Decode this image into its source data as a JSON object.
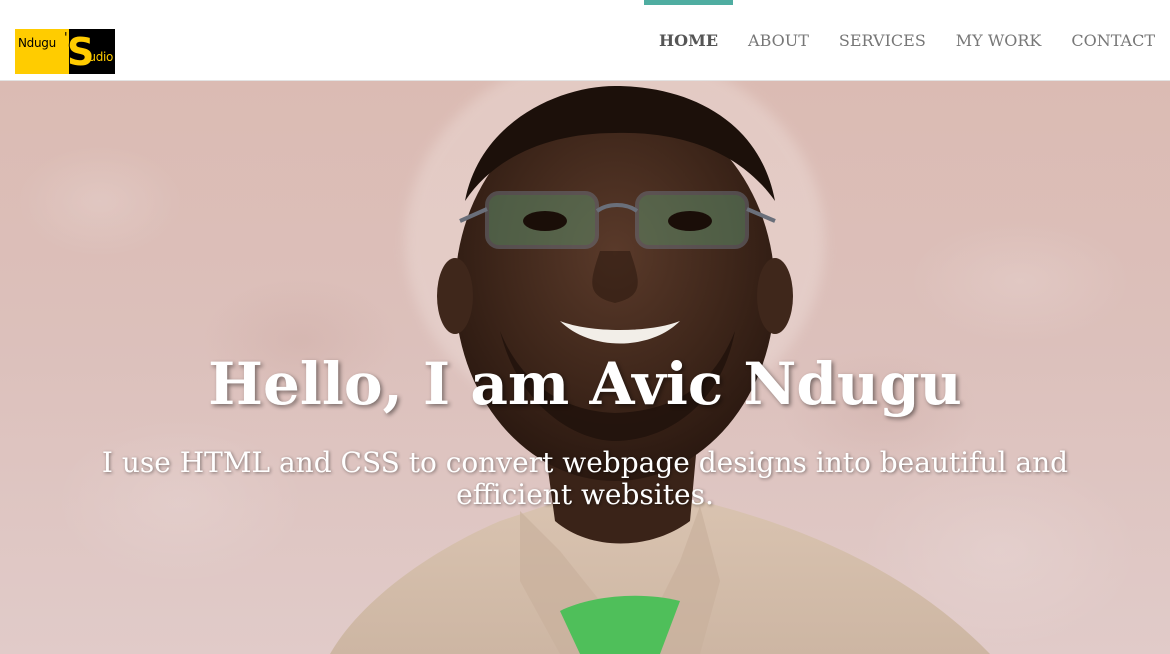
{
  "logo": {
    "word1": "Ndugu",
    "apostrophe": "'",
    "big_s": "S",
    "word2": "tudio"
  },
  "nav": {
    "items": [
      {
        "label": "HOME",
        "active": true
      },
      {
        "label": "ABOUT",
        "active": false
      },
      {
        "label": "SERVICES",
        "active": false
      },
      {
        "label": "MY WORK",
        "active": false
      },
      {
        "label": "CONTACT",
        "active": false
      }
    ]
  },
  "hero": {
    "title": "Hello, I am Avic Ndugu",
    "subtitle": "I use HTML and CSS to convert webpage designs into beautiful and efficient websites."
  },
  "colors": {
    "accent": "#4fada1",
    "logo_yellow": "#ffcc00",
    "nav_text": "#777777",
    "nav_active_text": "#555555"
  }
}
